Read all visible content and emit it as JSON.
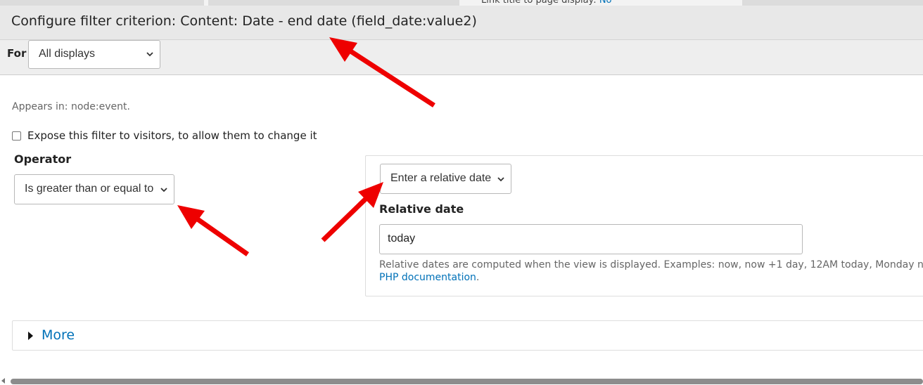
{
  "background": {
    "partial_text": "Link title to page display:",
    "partial_link": "No"
  },
  "dialog": {
    "title": "Configure filter criterion: Content: Date - end date (field_date:value2)"
  },
  "for_row": {
    "label": "For",
    "selected": "All displays"
  },
  "appears_in": "Appears in: node:event.",
  "expose": {
    "checked": false,
    "label": "Expose this filter to visitors, to allow them to change it"
  },
  "operator": {
    "label": "Operator",
    "selected": "Is greater than or equal to"
  },
  "value": {
    "type_selected": "Enter a relative date",
    "relative_label": "Relative date",
    "relative_value": "today",
    "help_text": "Relative dates are computed when the view is displayed. Examples: now, now +1 day, 12AM today, Monday next w",
    "help_link": "PHP documentation",
    "help_suffix": "."
  },
  "more": {
    "label": "More"
  },
  "colors": {
    "link": "#0071b8",
    "arrow": "#ee0000",
    "title_bar": "#e8e8e8"
  },
  "icons": {
    "select_chevron": "chevron-down-icon",
    "details_toggle": "triangle-right-icon",
    "annotation": "red-arrow-icon"
  }
}
